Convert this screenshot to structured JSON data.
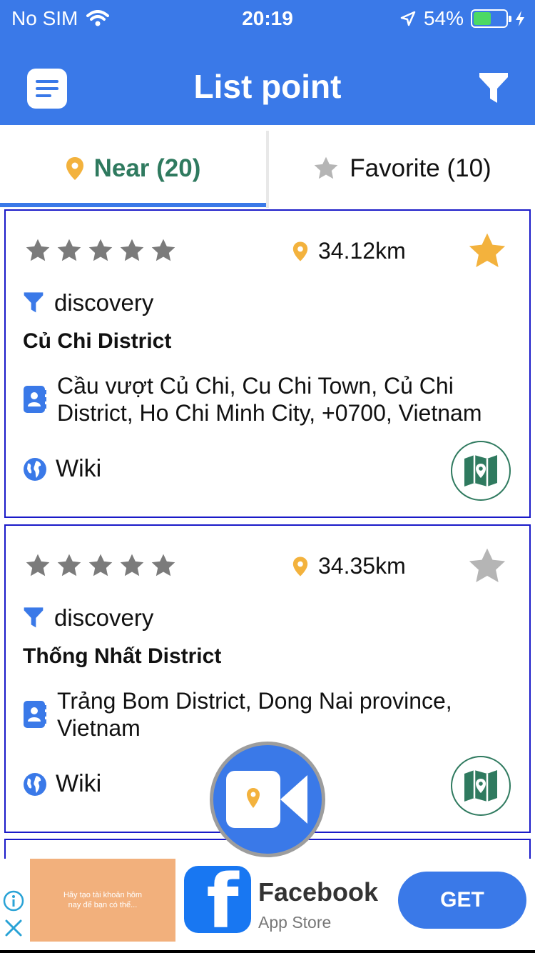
{
  "status_bar": {
    "carrier": "No SIM",
    "time": "20:19",
    "battery": "54%",
    "battery_level": 0.54
  },
  "header": {
    "title": "List point"
  },
  "tabs": [
    {
      "label": "Near (20)",
      "active": true
    },
    {
      "label": "Favorite (10)",
      "active": false
    }
  ],
  "points": [
    {
      "rating": 0,
      "distance": "34.12km",
      "favorite": true,
      "category": "discovery",
      "name": "Củ Chi District",
      "address": "Cầu vượt Củ Chi, Cu Chi Town, Củ Chi District, Ho Chi Minh City, +0700, Vietnam",
      "wiki_label": "Wiki"
    },
    {
      "rating": 0,
      "distance": "34.35km",
      "favorite": false,
      "category": "discovery",
      "name": "Thống Nhất District",
      "address": "Trảng Bom District, Dong Nai province, Vietnam",
      "wiki_label": "Wiki"
    }
  ],
  "ad": {
    "image_text": "Hãy tạo tài khoản hôm nay để bạn có thể...",
    "app_name": "Facebook",
    "store": "App Store",
    "cta": "GET"
  },
  "colors": {
    "primary": "#3a79e8",
    "accent_green": "#2f7a5f",
    "pin_orange": "#f3b23d",
    "star_gray": "#7b7b7b",
    "card_border": "#1a1ac8"
  }
}
